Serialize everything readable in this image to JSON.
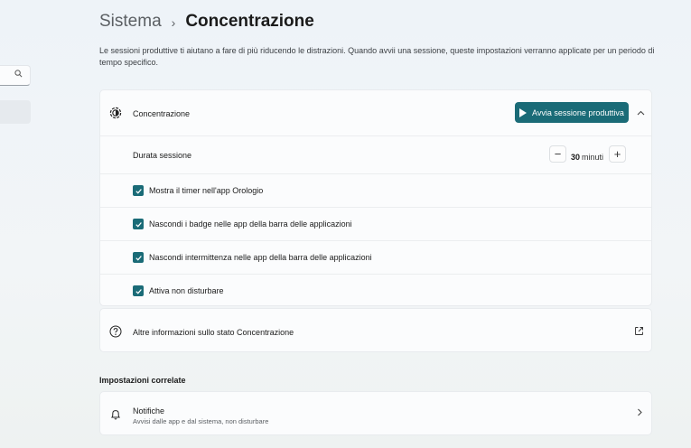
{
  "breadcrumb": {
    "parent": "Sistema",
    "separator": "›",
    "current": "Concentrazione"
  },
  "description": "Le sessioni produttive ti aiutano a fare di più riducendo le distrazioni. Quando avvii una sessione, queste impostazioni verranno applicate per un periodo di tempo specifico.",
  "search": {
    "icon": "search-icon"
  },
  "focus": {
    "label": "Concentrazione",
    "icon": "focus-clock-icon",
    "start_button": "Avvia sessione produttiva",
    "expanded": true
  },
  "duration": {
    "label": "Durata sessione",
    "value": "30",
    "unit": "minuti",
    "minus": "−",
    "plus": "+"
  },
  "options": [
    {
      "label": "Mostra il timer nell'app Orologio",
      "checked": true
    },
    {
      "label": "Nascondi i badge nelle app della barra delle applicazioni",
      "checked": true
    },
    {
      "label": "Nascondi intermittenza nelle app della barra delle applicazioni",
      "checked": true
    },
    {
      "label": "Attiva non disturbare",
      "checked": true
    }
  ],
  "info": {
    "label": "Altre informazioni sullo stato Concentrazione",
    "icon": "help-icon"
  },
  "related": {
    "title": "Impostazioni correlate",
    "notifications": {
      "title": "Notifiche",
      "subtitle": "Avvisi dalle app e dal sistema, non disturbare"
    }
  },
  "colors": {
    "accent": "#1a6b77"
  }
}
